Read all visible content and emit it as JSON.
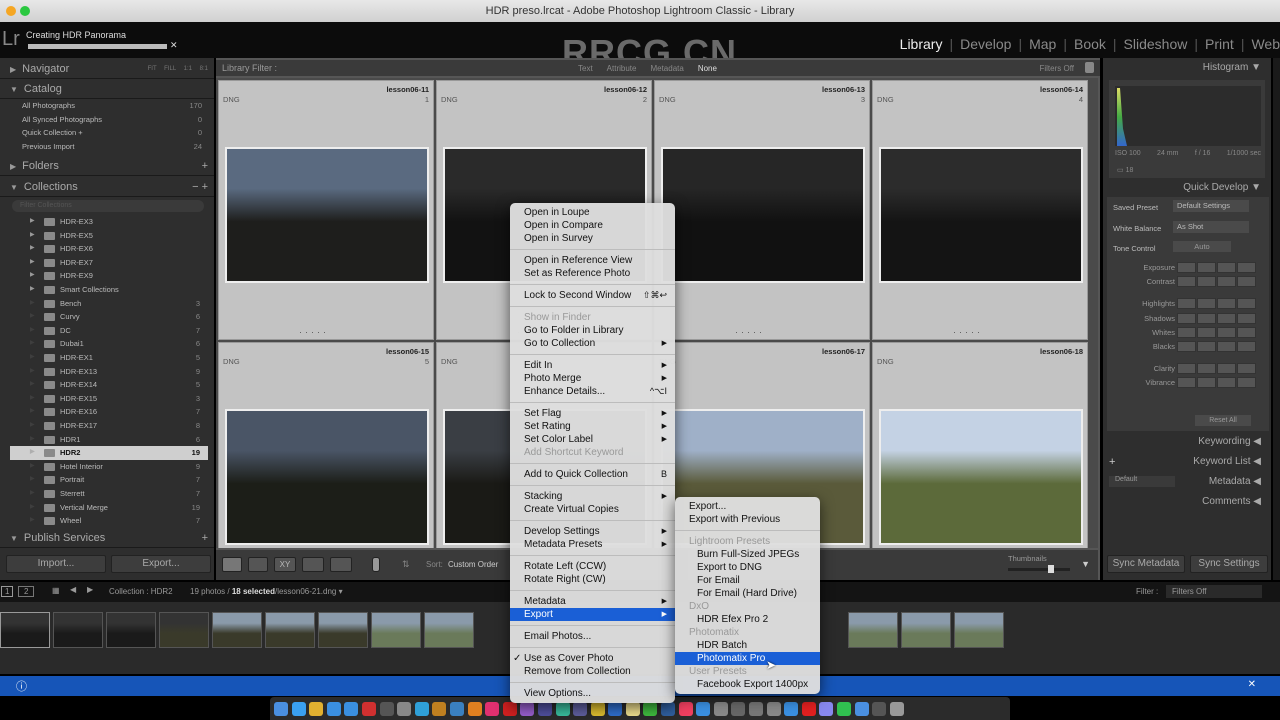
{
  "window": {
    "title": "HDR preso.lrcat - Adobe Photoshop Lightroom Classic - Library"
  },
  "topbar": {
    "logo": "Lr",
    "task": "Creating HDR Panorama",
    "task_progress": 0.98,
    "watermark": "RRCG.CN",
    "modules": [
      {
        "label": "Library",
        "active": true
      },
      {
        "label": "Develop"
      },
      {
        "label": "Map"
      },
      {
        "label": "Book"
      },
      {
        "label": "Slideshow"
      },
      {
        "label": "Print"
      },
      {
        "label": "Web"
      }
    ]
  },
  "left": {
    "navigator": {
      "title": "Navigator",
      "zoom": [
        "FIT",
        "FILL",
        "1:1",
        "8:1"
      ]
    },
    "catalog": {
      "title": "Catalog",
      "items": [
        {
          "label": "All Photographs",
          "count": "170"
        },
        {
          "label": "All Synced Photographs",
          "count": "0"
        },
        {
          "label": "Quick Collection +",
          "count": "0"
        },
        {
          "label": "Previous Import",
          "count": "24"
        }
      ]
    },
    "folders": {
      "title": "Folders"
    },
    "collections": {
      "title": "Collections",
      "filter_placeholder": "Filter Collections",
      "items": [
        {
          "label": "HDR-EX3",
          "set": true
        },
        {
          "label": "HDR-EX5",
          "set": true
        },
        {
          "label": "HDR-EX6",
          "set": true
        },
        {
          "label": "HDR-EX7",
          "set": true
        },
        {
          "label": "HDR-EX9",
          "set": true
        },
        {
          "label": "Smart Collections",
          "set": true
        },
        {
          "label": "Bench",
          "count": "3"
        },
        {
          "label": "Curvy",
          "count": "6"
        },
        {
          "label": "DC",
          "count": "7"
        },
        {
          "label": "Dubai1",
          "count": "6"
        },
        {
          "label": "HDR-EX1",
          "count": "5"
        },
        {
          "label": "HDR-EX13",
          "count": "9"
        },
        {
          "label": "HDR-EX14",
          "count": "5"
        },
        {
          "label": "HDR-EX15",
          "count": "3"
        },
        {
          "label": "HDR-EX16",
          "count": "7"
        },
        {
          "label": "HDR-EX17",
          "count": "8"
        },
        {
          "label": "HDR1",
          "count": "6"
        },
        {
          "label": "HDR2",
          "count": "19",
          "selected": true
        },
        {
          "label": "Hotel Interior",
          "count": "9"
        },
        {
          "label": "Portrait",
          "count": "7"
        },
        {
          "label": "Sterrett",
          "count": "7"
        },
        {
          "label": "Vertical Merge",
          "count": "19"
        },
        {
          "label": "Wheel",
          "count": "7"
        }
      ]
    },
    "publish": {
      "title": "Publish Services"
    },
    "import_label": "Import...",
    "export_label": "Export..."
  },
  "filter": {
    "label": "Library Filter :",
    "options": [
      "Text",
      "Attribute",
      "Metadata",
      "None"
    ],
    "active": "None",
    "preset": "Filters Off"
  },
  "grid": {
    "cells": [
      {
        "name": "lesson06-11",
        "type": "DNG",
        "index": "1"
      },
      {
        "name": "lesson06-12",
        "type": "DNG",
        "index": "2"
      },
      {
        "name": "lesson06-13",
        "type": "DNG",
        "index": "3"
      },
      {
        "name": "lesson06-14",
        "type": "DNG",
        "index": "4"
      },
      {
        "name": "lesson06-15",
        "type": "DNG",
        "index": "5"
      },
      {
        "name": "",
        "type": "DNG",
        "index": ""
      },
      {
        "name": "lesson06-17",
        "type": "DNG",
        "index": ""
      },
      {
        "name": "lesson06-18",
        "type": "DNG",
        "index": ""
      }
    ]
  },
  "toolbar": {
    "sort_label": "Sort:",
    "sort_value": "Custom Order",
    "thumbnails_label": "Thumbnails",
    "thumbnail_size": 0.7
  },
  "right": {
    "histogram": {
      "title": "Histogram",
      "iso": "ISO 100",
      "focal": "24 mm",
      "aperture": "f / 16",
      "shutter": "1/1000 sec",
      "count": "18"
    },
    "quick_develop": {
      "title": "Quick Develop",
      "saved_preset_label": "Saved Preset",
      "saved_preset": "Default Settings",
      "wb_label": "White Balance",
      "wb": "As Shot",
      "tone_label": "Tone Control",
      "auto": "Auto",
      "rows": [
        "Exposure",
        "Contrast",
        "Highlights",
        "Shadows",
        "Whites",
        "Blacks",
        "Clarity",
        "Vibrance"
      ],
      "reset": "Reset All"
    },
    "keywording": "Keywording",
    "keyword_list": "Keyword List",
    "metadata": "Metadata",
    "metadata_preset": "Default",
    "comments": "Comments",
    "sync_metadata": "Sync Metadata",
    "sync_settings": "Sync Settings"
  },
  "filmbar": {
    "page1": "1",
    "page2": "2",
    "source": "Collection : HDR2",
    "photos": "19 photos /",
    "selected": "18 selected",
    "file": "/lesson06-21.dng",
    "filter_label": "Filter :",
    "filter_value": "Filters Off"
  },
  "context_menu": {
    "items": [
      {
        "label": "Open in Loupe"
      },
      {
        "label": "Open in Compare"
      },
      {
        "label": "Open in Survey"
      },
      {
        "sep": true
      },
      {
        "label": "Open in Reference View"
      },
      {
        "label": "Set as Reference Photo"
      },
      {
        "sep": true
      },
      {
        "label": "Lock to Second Window",
        "shortcut": "⇧⌘↩"
      },
      {
        "sep": true
      },
      {
        "label": "Show in Finder",
        "disabled": true
      },
      {
        "label": "Go to Folder in Library"
      },
      {
        "label": "Go to Collection",
        "submenu": true
      },
      {
        "sep": true
      },
      {
        "label": "Edit In",
        "submenu": true
      },
      {
        "label": "Photo Merge",
        "submenu": true
      },
      {
        "label": "Enhance Details...",
        "shortcut": "^⌥I"
      },
      {
        "sep": true
      },
      {
        "label": "Set Flag",
        "submenu": true
      },
      {
        "label": "Set Rating",
        "submenu": true
      },
      {
        "label": "Set Color Label",
        "submenu": true
      },
      {
        "label": "Add Shortcut Keyword",
        "disabled": true
      },
      {
        "sep": true
      },
      {
        "label": "Add to Quick Collection",
        "shortcut": "B"
      },
      {
        "sep": true
      },
      {
        "label": "Stacking",
        "submenu": true
      },
      {
        "label": "Create Virtual Copies"
      },
      {
        "sep": true
      },
      {
        "label": "Develop Settings",
        "submenu": true
      },
      {
        "label": "Metadata Presets",
        "submenu": true
      },
      {
        "sep": true
      },
      {
        "label": "Rotate Left (CCW)"
      },
      {
        "label": "Rotate Right (CW)"
      },
      {
        "sep": true
      },
      {
        "label": "Metadata",
        "submenu": true
      },
      {
        "label": "Export",
        "submenu": true,
        "highlighted": true
      },
      {
        "sep": true
      },
      {
        "label": "Email Photos..."
      },
      {
        "sep": true
      },
      {
        "label": "Use as Cover Photo",
        "checked": true
      },
      {
        "label": "Remove from Collection"
      },
      {
        "sep": true
      },
      {
        "label": "View Options..."
      }
    ]
  },
  "export_submenu": {
    "items": [
      {
        "label": "Export..."
      },
      {
        "label": "Export with Previous"
      },
      {
        "sep": true
      },
      {
        "label": "Lightroom Presets",
        "section": true
      },
      {
        "label": "Burn Full-Sized JPEGs",
        "sub": true
      },
      {
        "label": "Export to DNG",
        "sub": true
      },
      {
        "label": "For Email",
        "sub": true
      },
      {
        "label": "For Email (Hard Drive)",
        "sub": true
      },
      {
        "label": "DxO",
        "section": true
      },
      {
        "label": "HDR Efex Pro 2",
        "sub": true
      },
      {
        "label": "Photomatix",
        "section": true
      },
      {
        "label": "HDR Batch",
        "sub": true
      },
      {
        "label": "Photomatix Pro",
        "sub": true,
        "highlighted": true
      },
      {
        "label": "User Presets",
        "section": true
      },
      {
        "label": "Facebook Export 1400px",
        "sub": true
      }
    ]
  },
  "colors": {
    "accent": "#1a5fd6",
    "notification": "#1655b8",
    "panel": "#2e2e2e",
    "cell": "#c3c3c3"
  },
  "dock": [
    "finder",
    "messages",
    "chrome",
    "safari",
    "things",
    "screenflow",
    "steam",
    "filemerge",
    "photoshop",
    "bridge",
    "lightroom",
    "illustrator",
    "indesign",
    "acrobat",
    "premiere",
    "rush",
    "audition",
    "launchpad",
    "pineapple",
    "1password",
    "notes",
    "facetime",
    "keynote",
    "itunes",
    "app-store",
    "system-preferences",
    "preview",
    "automator",
    "rocket",
    "framer",
    "roblox",
    "proxy",
    "spotify",
    "quicktime",
    "downloads",
    "trash"
  ]
}
